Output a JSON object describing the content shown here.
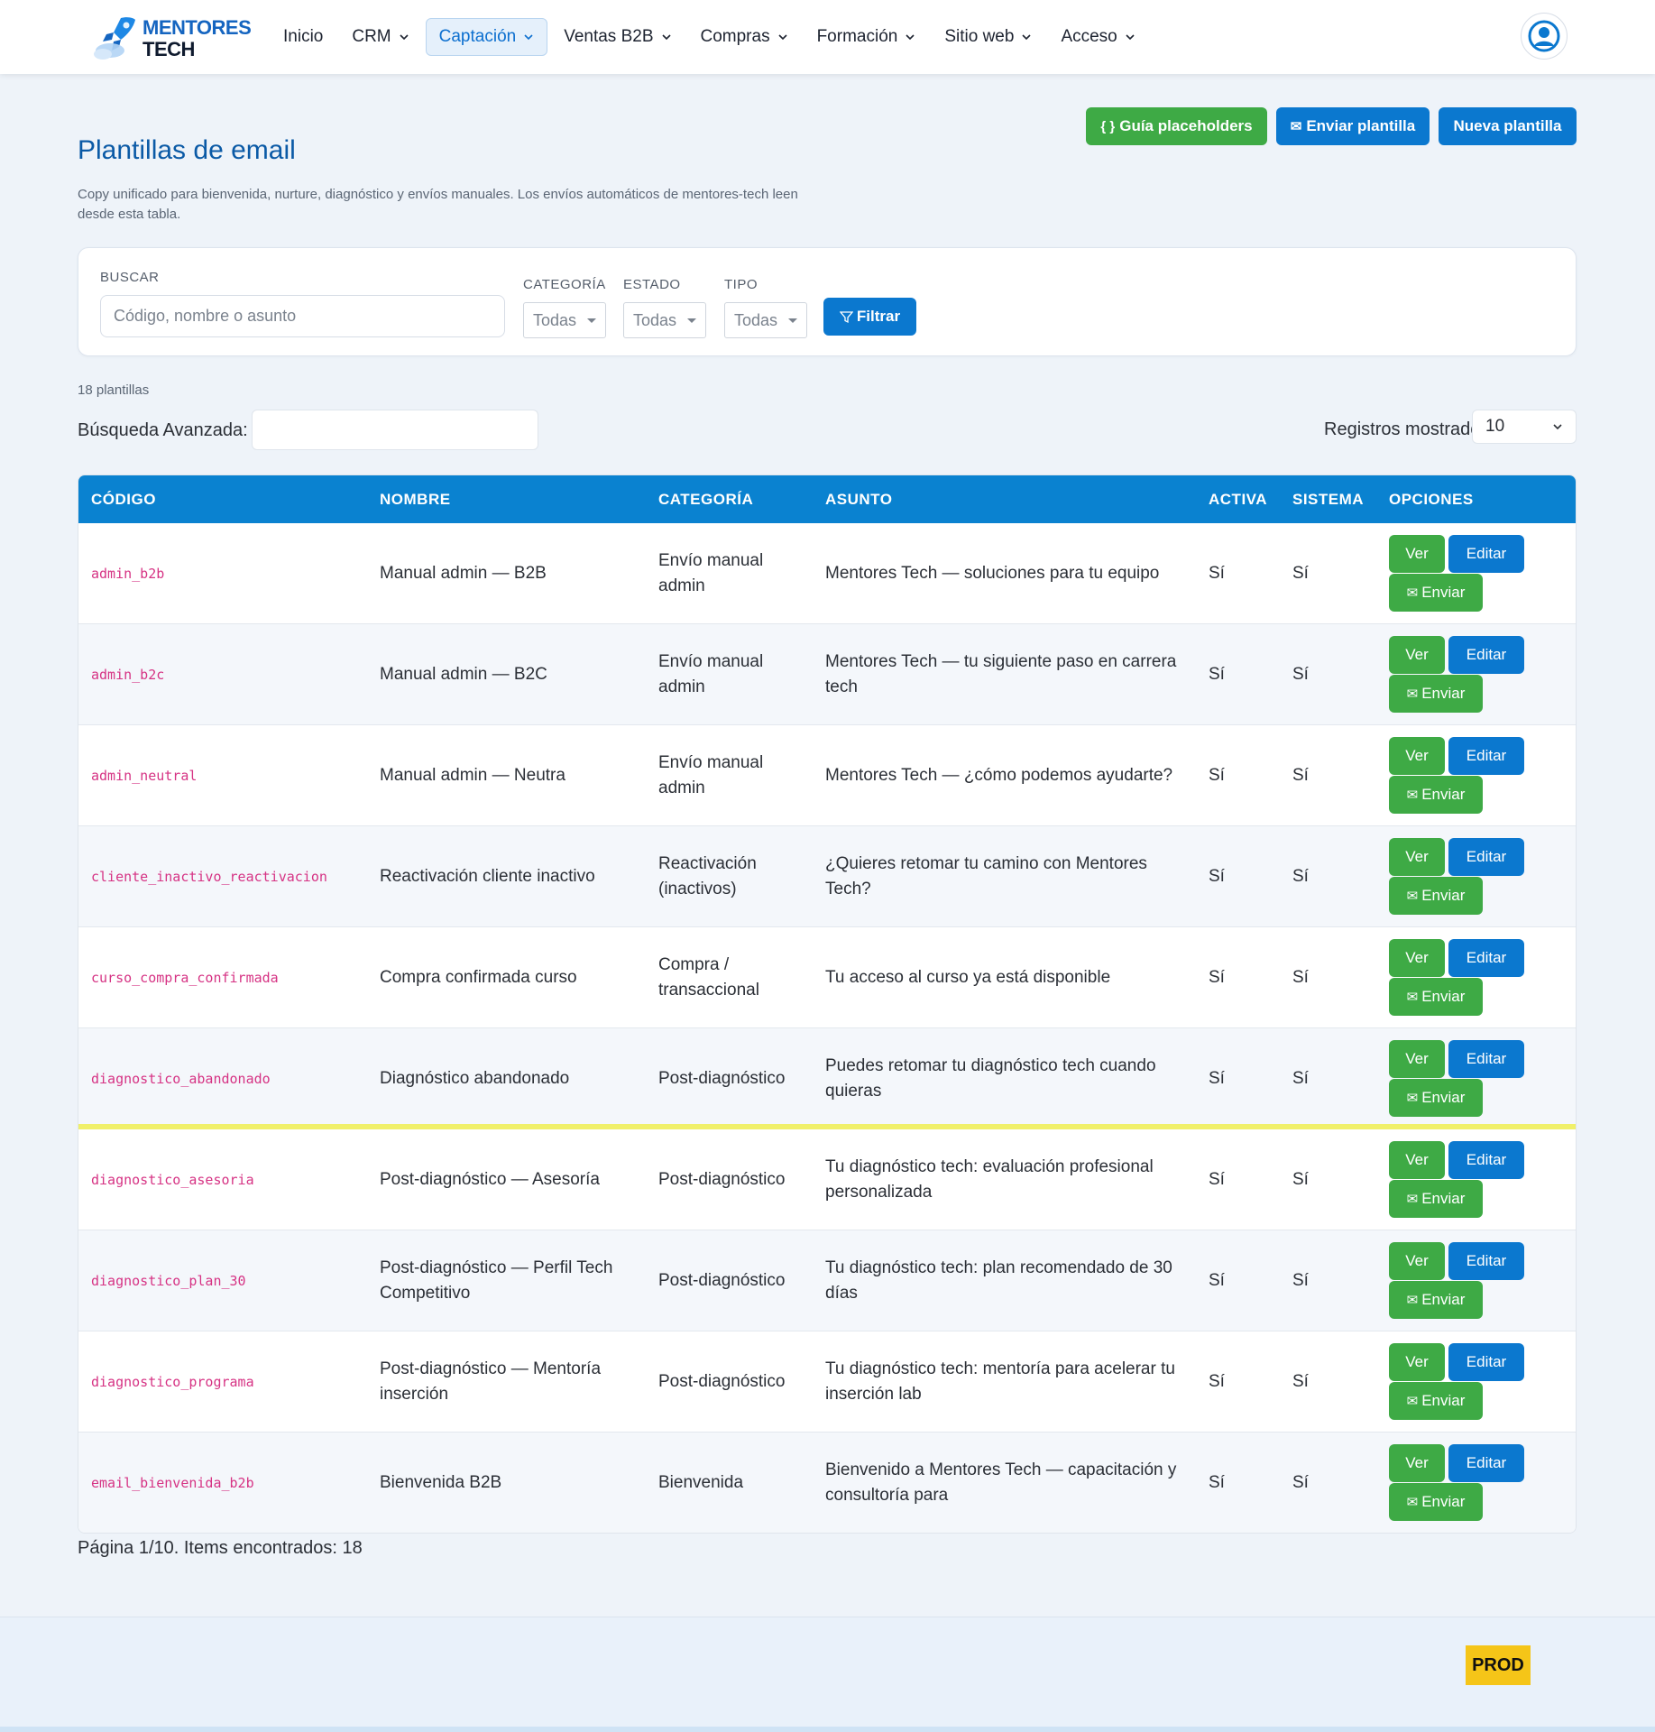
{
  "nav": {
    "brand_line1": "MENTORES",
    "brand_line2": "TECH",
    "items": [
      {
        "label": "Inicio",
        "dropdown": false
      },
      {
        "label": "CRM",
        "dropdown": true
      },
      {
        "label": "Captación",
        "dropdown": true,
        "active": true
      },
      {
        "label": "Ventas B2B",
        "dropdown": true
      },
      {
        "label": "Compras",
        "dropdown": true
      },
      {
        "label": "Formación",
        "dropdown": true
      },
      {
        "label": "Sitio web",
        "dropdown": true
      },
      {
        "label": "Acceso",
        "dropdown": true
      }
    ],
    "user_icon": "user-circle-icon"
  },
  "header": {
    "title": "Plantillas de email",
    "subtitle": "Copy unificado para bienvenida, nurture, diagnóstico y envíos manuales. Los envíos automáticos de mentores-tech leen desde esta tabla.",
    "buttons": {
      "guide": "Guía placeholders",
      "guide_icon": "{ }",
      "send": "Enviar plantilla",
      "send_icon": "✉",
      "new": "Nueva plantilla"
    }
  },
  "filters": {
    "search_label": "BUSCAR",
    "search_placeholder": "Código, nombre o asunto",
    "category_label": "CATEGORÍA",
    "category_value": "Todas",
    "state_label": "ESTADO",
    "state_value": "Todas",
    "type_label": "TIPO",
    "type_value": "Todas",
    "filter_button": "Filtrar",
    "filter_icon": "⏷"
  },
  "list": {
    "count": "18 plantillas",
    "advanced_search_label": "Búsqueda Avanzada:",
    "records_label": "Registros mostrados:",
    "records_value": "10"
  },
  "table": {
    "columns": [
      "CÓDIGO",
      "NOMBRE",
      "CATEGORÍA",
      "ASUNTO",
      "ACTIVA",
      "SISTEMA",
      "OPCIONES"
    ],
    "action_labels": {
      "ver": "Ver",
      "editar": "Editar",
      "enviar": "Enviar",
      "enviar_icon": "✉"
    },
    "rows": [
      {
        "code": "admin_b2b",
        "name": "Manual admin — B2B",
        "category": "Envío manual admin",
        "subject": "Mentores Tech — soluciones para tu equipo",
        "active": "Sí",
        "system": "Sí"
      },
      {
        "code": "admin_b2c",
        "name": "Manual admin — B2C",
        "category": "Envío manual admin",
        "subject": "Mentores Tech — tu siguiente paso en carrera tech",
        "active": "Sí",
        "system": "Sí"
      },
      {
        "code": "admin_neutral",
        "name": "Manual admin — Neutra",
        "category": "Envío manual admin",
        "subject": "Mentores Tech — ¿cómo podemos ayudarte?",
        "active": "Sí",
        "system": "Sí"
      },
      {
        "code": "cliente_inactivo_reactivacion",
        "name": "Reactivación cliente inactivo",
        "category": "Reactivación (inactivos)",
        "subject": "¿Quieres retomar tu camino con Mentores Tech?",
        "active": "Sí",
        "system": "Sí"
      },
      {
        "code": "curso_compra_confirmada",
        "name": "Compra confirmada curso",
        "category": "Compra / transaccional",
        "subject": "Tu acceso al curso ya está disponible",
        "active": "Sí",
        "system": "Sí"
      },
      {
        "code": "diagnostico_abandonado",
        "name": "Diagnóstico abandonado",
        "category": "Post-diagnóstico",
        "subject": "Puedes retomar tu diagnóstico tech cuando quieras",
        "active": "Sí",
        "system": "Sí"
      },
      {
        "code": "diagnostico_asesoria",
        "name": "Post-diagnóstico — Asesoría",
        "category": "Post-diagnóstico",
        "subject": "Tu diagnóstico tech: evaluación profesional personalizada",
        "active": "Sí",
        "system": "Sí"
      },
      {
        "code": "diagnostico_plan_30",
        "name": "Post-diagnóstico — Perfil Tech Competitivo",
        "category": "Post-diagnóstico",
        "subject": "Tu diagnóstico tech: plan recomendado de 30 días",
        "active": "Sí",
        "system": "Sí"
      },
      {
        "code": "diagnostico_programa",
        "name": "Post-diagnóstico — Mentoría inserción",
        "category": "Post-diagnóstico",
        "subject": "Tu diagnóstico tech: mentoría para acelerar tu inserción lab",
        "active": "Sí",
        "system": "Sí"
      },
      {
        "code": "email_bienvenida_b2b",
        "name": "Bienvenida B2B",
        "category": "Bienvenida",
        "subject": "Bienvenido a Mentores Tech — capacitación y consultoría para",
        "active": "Sí",
        "system": "Sí"
      }
    ]
  },
  "pagination": {
    "text": "Página 1/10. Items encontrados: 18"
  },
  "footer": {
    "env_badge": "PROD"
  },
  "colors": {
    "primary": "#0b78cf",
    "success": "#3eaa45",
    "header": "#0a82d0",
    "code": "#d63384",
    "badge": "#f5c518"
  }
}
